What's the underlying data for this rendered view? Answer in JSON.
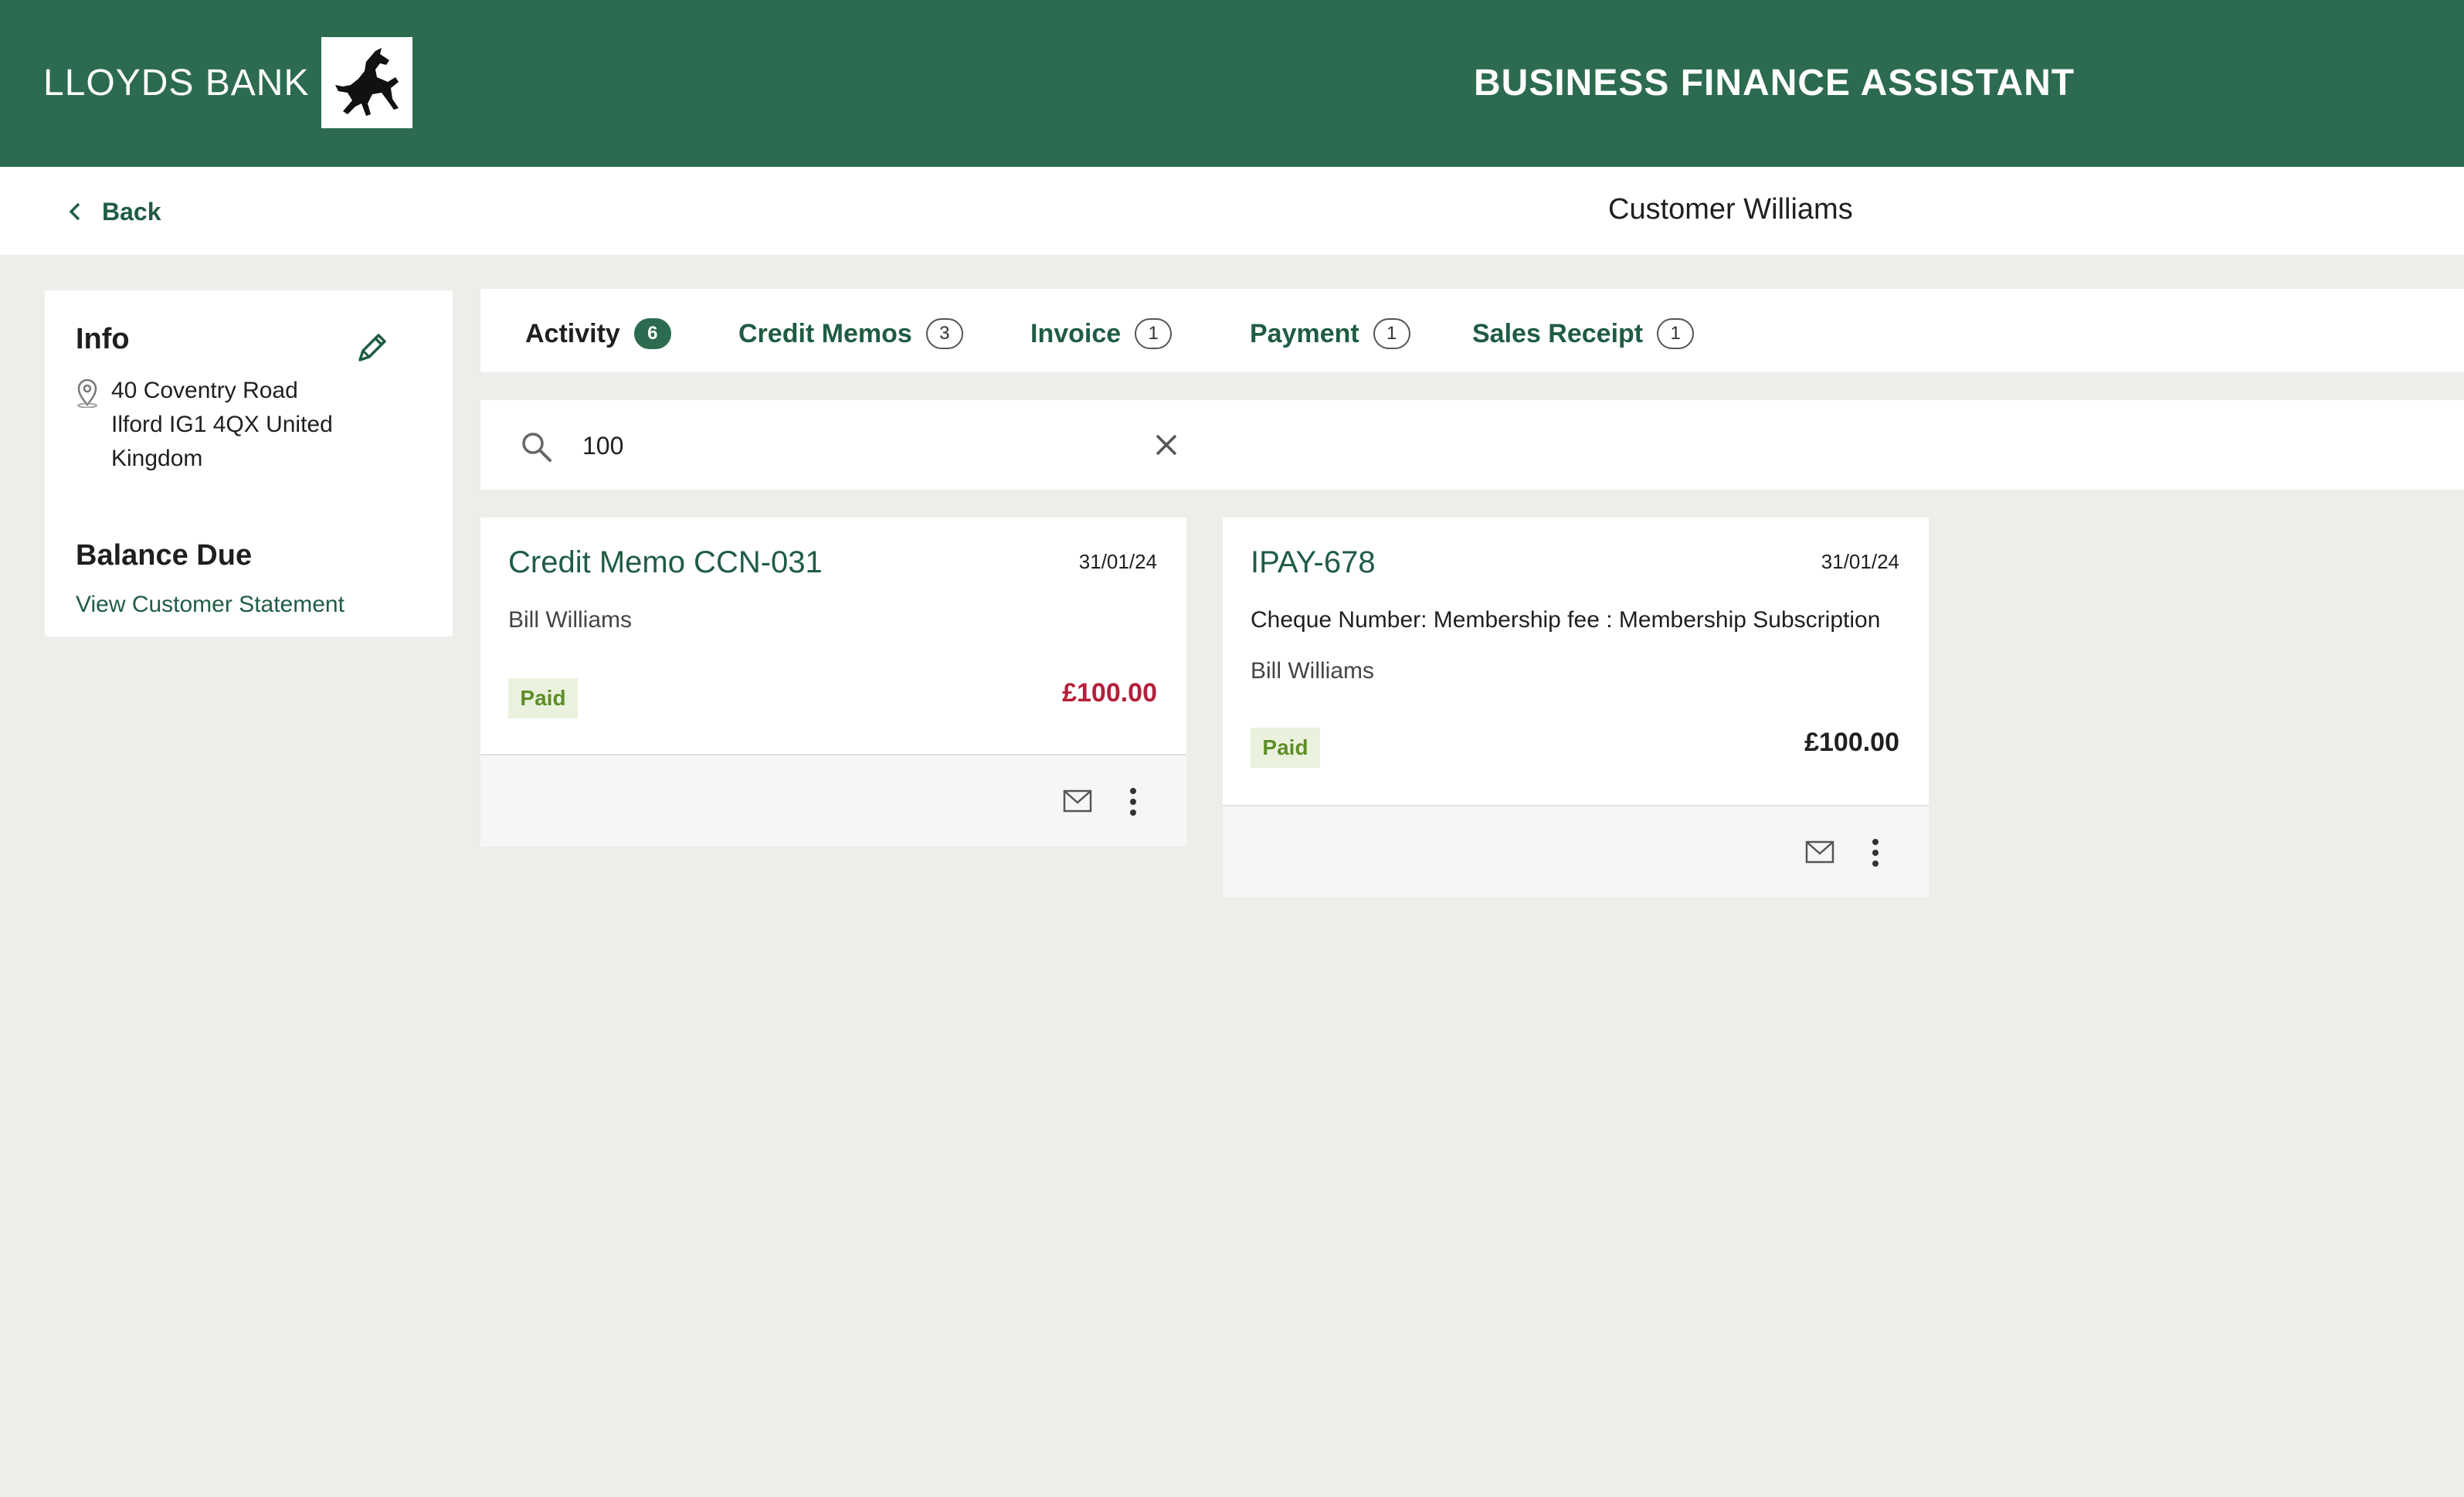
{
  "header": {
    "brand": "LLOYDS BANK",
    "app_title": "BUSINESS FINANCE ASSISTANT",
    "brand_color": "#2c6b50"
  },
  "subheader": {
    "back_label": "Back",
    "title": "Customer Williams"
  },
  "info": {
    "heading": "Info",
    "address_line1": "40 Coventry Road",
    "address_line2": "Ilford IG1 4QX United",
    "address_line3": "Kingdom",
    "balance_heading": "Balance Due",
    "statement_link": "View Customer Statement"
  },
  "tabs": [
    {
      "label": "Activity",
      "count": "6",
      "active": true
    },
    {
      "label": "Credit Memos",
      "count": "3"
    },
    {
      "label": "Invoice",
      "count": "1"
    },
    {
      "label": "Payment",
      "count": "1"
    },
    {
      "label": "Sales Receipt",
      "count": "1"
    }
  ],
  "search": {
    "value": "100",
    "icon": "search-icon",
    "clear_icon": "close-icon"
  },
  "cards": [
    {
      "title": "Credit Memo CCN-031",
      "date": "31/01/24",
      "customer": "Bill Williams",
      "status": "Paid",
      "amount": "£100.00",
      "amount_color": "#b3203a"
    },
    {
      "title": "IPAY-678",
      "date": "31/01/24",
      "description": "Cheque Number: Membership fee  : Membership Subscription",
      "customer": "Bill Williams",
      "status": "Paid",
      "amount": "£100.00",
      "amount_color": "#1f1f1f"
    }
  ]
}
